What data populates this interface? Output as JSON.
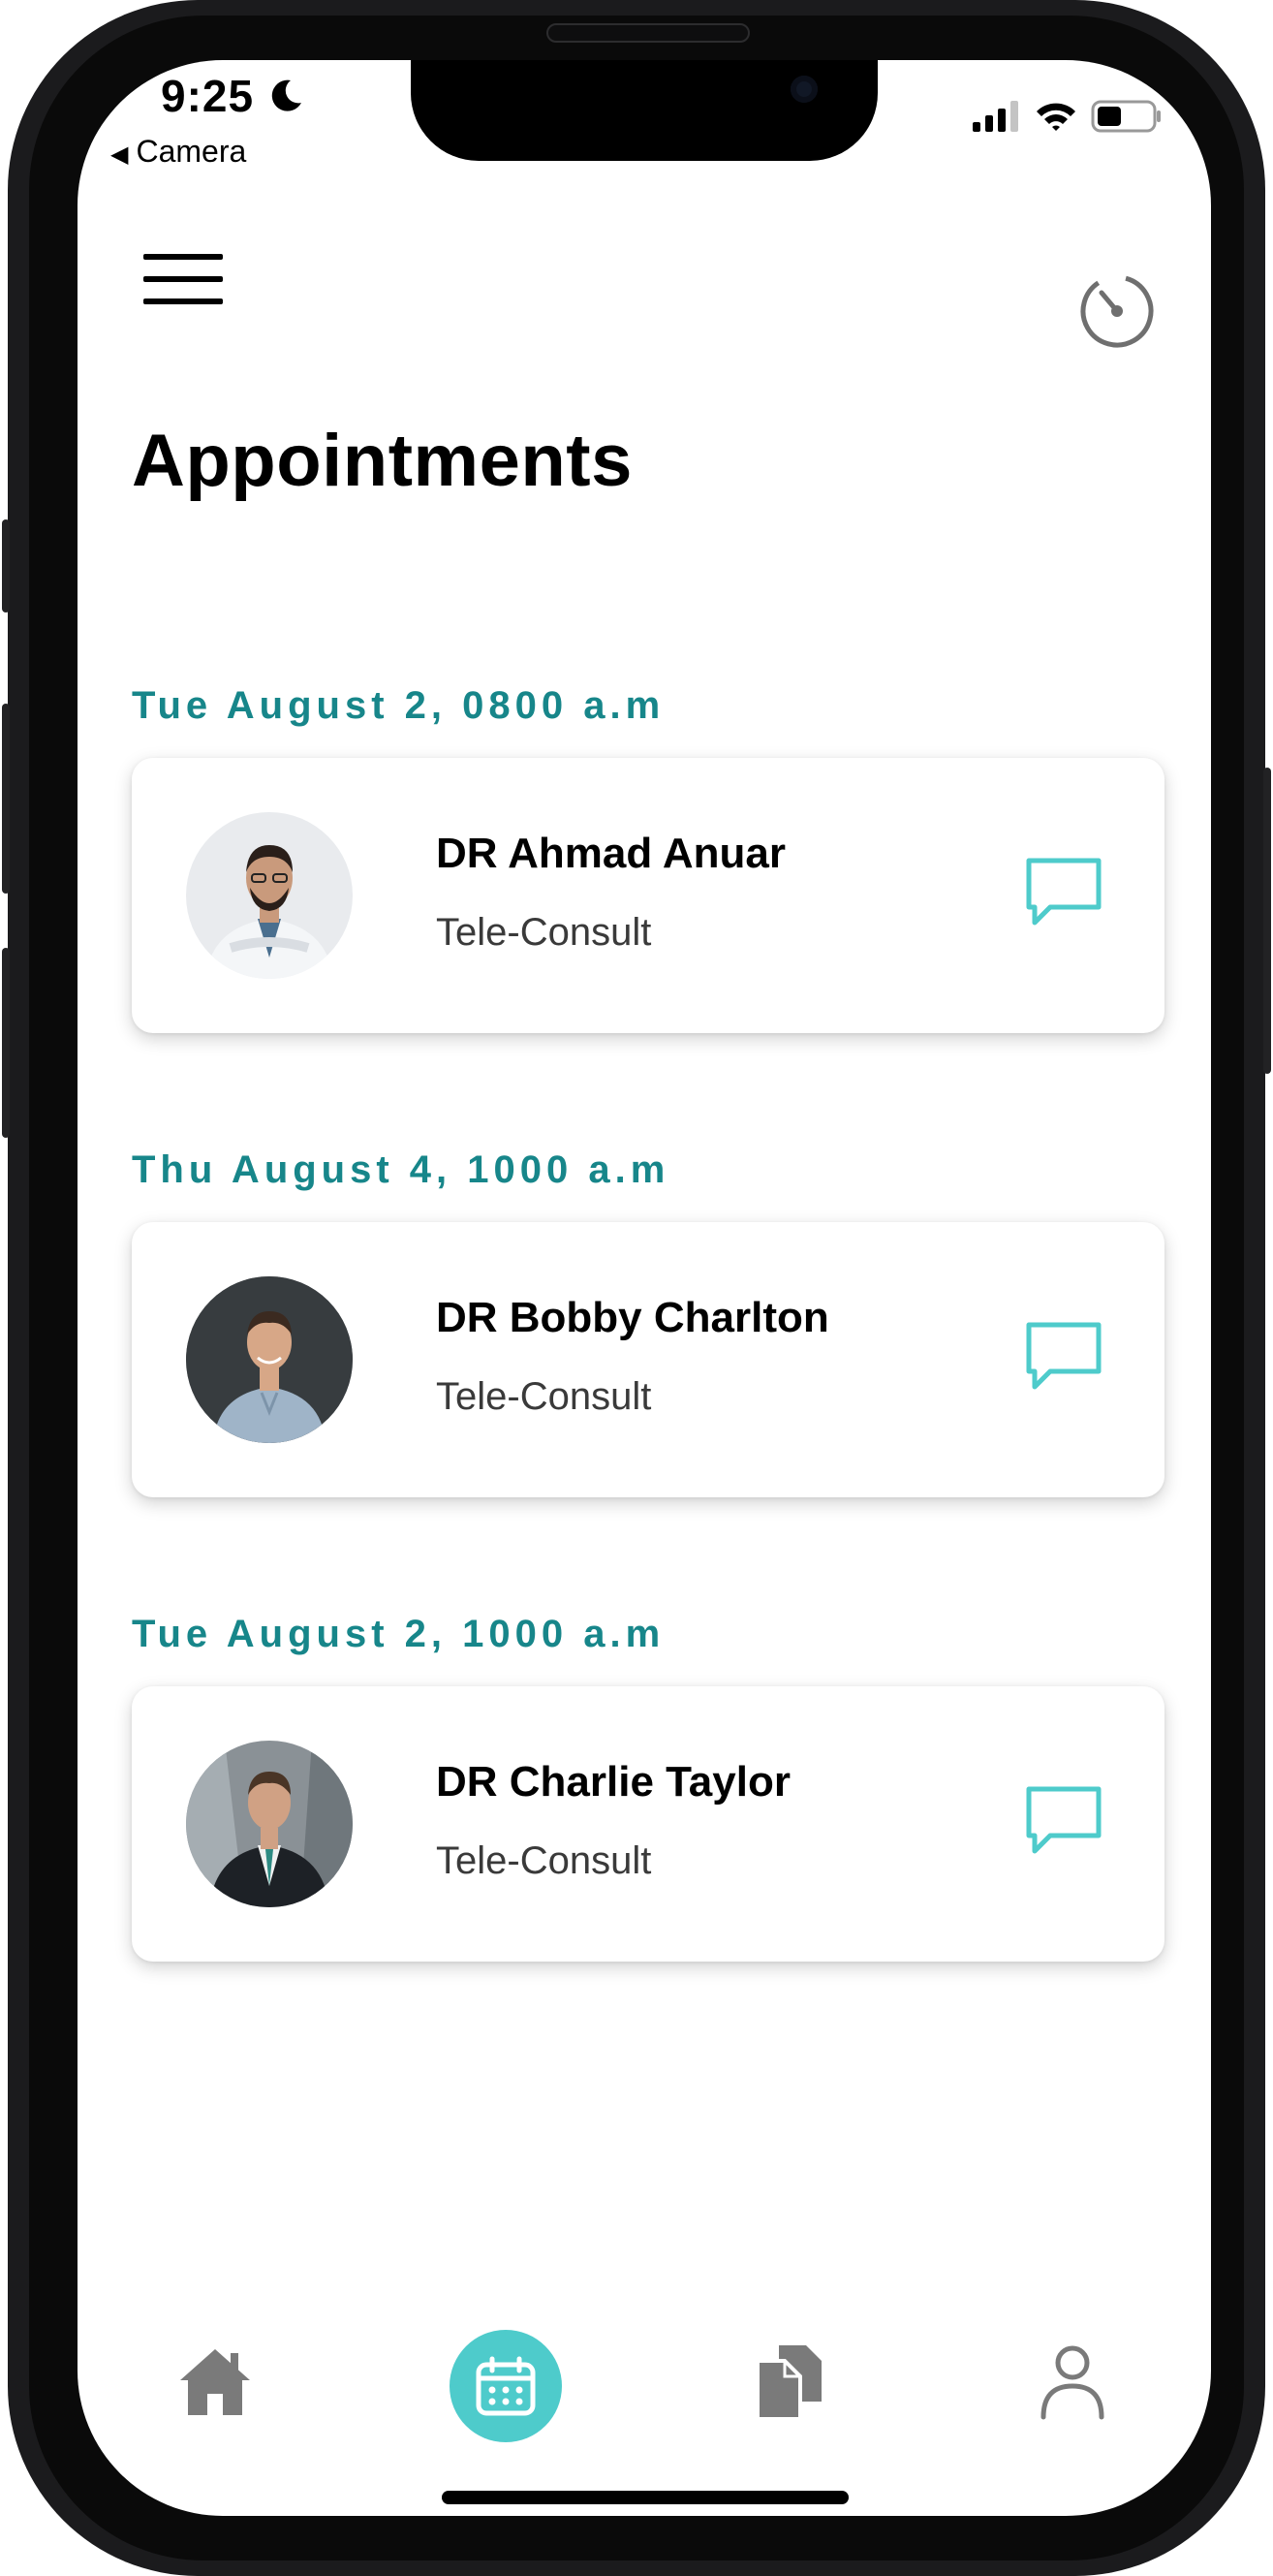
{
  "status_bar": {
    "time": "9:25",
    "back_app": "Camera"
  },
  "header": {
    "menu_icon": "hamburger-menu-icon",
    "timer_icon": "timer-icon",
    "title": "Appointments"
  },
  "appointments": [
    {
      "datetime": "Tue August 2, 0800 a.m",
      "doctor": "DR Ahmad Anuar",
      "type": "Tele-Consult",
      "action_icon": "chat-bubble-icon"
    },
    {
      "datetime": "Thu August 4, 1000 a.m",
      "doctor": "DR Bobby Charlton",
      "type": "Tele-Consult",
      "action_icon": "chat-bubble-icon"
    },
    {
      "datetime": "Tue August 2, 1000 a.m",
      "doctor": "DR Charlie Taylor",
      "type": "Tele-Consult",
      "action_icon": "chat-bubble-icon"
    }
  ],
  "tab_bar": {
    "tabs": [
      {
        "icon": "home-icon",
        "active": false
      },
      {
        "icon": "calendar-icon",
        "active": true
      },
      {
        "icon": "documents-icon",
        "active": false
      },
      {
        "icon": "profile-icon",
        "active": false
      }
    ]
  },
  "colors": {
    "accent": "#4ecbcb",
    "date_text": "#17868a",
    "inactive_icon": "#7a7a7a"
  }
}
